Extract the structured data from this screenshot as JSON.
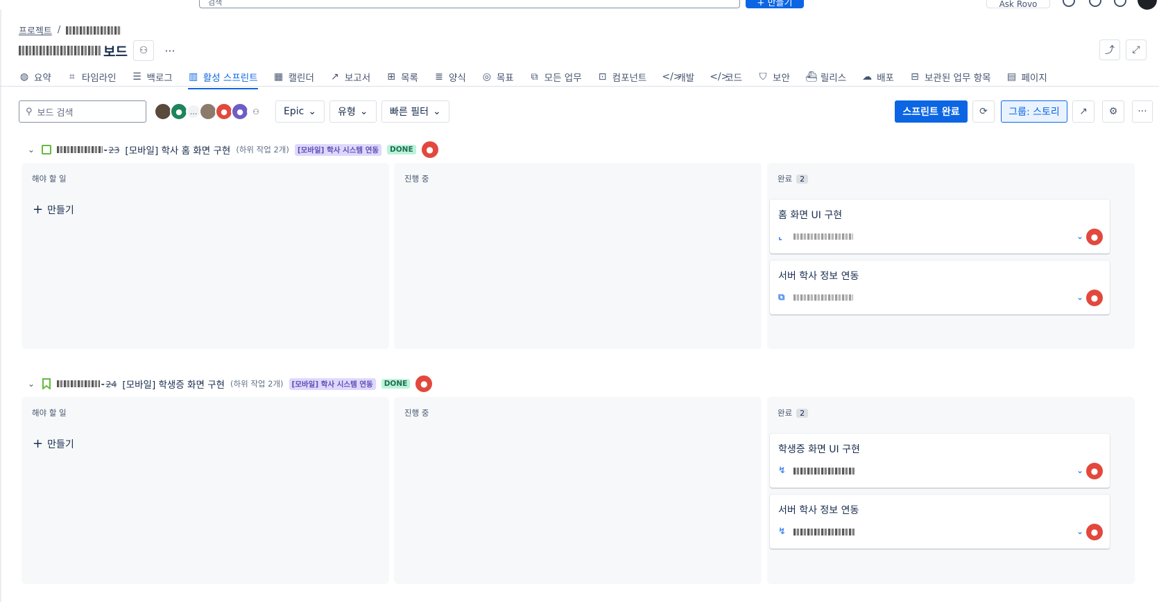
{
  "topbar": {
    "search_placeholder": "검색",
    "create_label": "+ 만들기",
    "rovo_label": "Ask Rovo"
  },
  "breadcrumb": {
    "root": "프로젝트",
    "separator": "/"
  },
  "board": {
    "title_suffix": "보드"
  },
  "tabs": [
    {
      "label": "요약",
      "icon": "globe-icon",
      "glyph": "◍"
    },
    {
      "label": "타임라인",
      "icon": "timeline-icon",
      "glyph": "⌗"
    },
    {
      "label": "백로그",
      "icon": "backlog-icon",
      "glyph": "☰"
    },
    {
      "label": "활성 스프린트",
      "icon": "board-icon",
      "glyph": "▥",
      "active": true
    },
    {
      "label": "캘린더",
      "icon": "calendar-icon",
      "glyph": "▦"
    },
    {
      "label": "보고서",
      "icon": "chart-line-icon",
      "glyph": "↗"
    },
    {
      "label": "목록",
      "icon": "list-icon",
      "glyph": "⊞"
    },
    {
      "label": "양식",
      "icon": "form-icon",
      "glyph": "≣"
    },
    {
      "label": "목표",
      "icon": "goal-icon",
      "glyph": "◎"
    },
    {
      "label": "모든 업무",
      "icon": "all-work-icon",
      "glyph": "⧉"
    },
    {
      "label": "컴포넌트",
      "icon": "component-icon",
      "glyph": "⊡"
    },
    {
      "label": "개발",
      "icon": "code-icon",
      "glyph": "</>"
    },
    {
      "label": "코드",
      "icon": "code-icon",
      "glyph": "</>"
    },
    {
      "label": "보안",
      "icon": "shield-icon",
      "glyph": "⛉"
    },
    {
      "label": "릴리스",
      "icon": "ship-icon",
      "glyph": "⛴"
    },
    {
      "label": "배포",
      "icon": "cloud-upload-icon",
      "glyph": "☁"
    },
    {
      "label": "보관된 업무 항목",
      "icon": "archive-icon",
      "glyph": "⊟"
    },
    {
      "label": "페이지",
      "icon": "page-icon",
      "glyph": "▤"
    }
  ],
  "toolbar": {
    "search_placeholder": "보드 검색",
    "epic_label": "Epic",
    "type_label": "유형",
    "quick_filter_label": "빠른 필터",
    "complete_sprint_label": "스프린트 완료",
    "group_label": "그룹: 스토리",
    "avatar_more": "..."
  },
  "columns": {
    "todo": "해야 할 일",
    "in_progress": "진행 중",
    "done": "완료"
  },
  "create_label": "만들기",
  "swimlanes": [
    {
      "key_suffix": "23",
      "title": "[모바일] 학사 홈 화면 구현",
      "subtasks": "(하위 작업 2개)",
      "epic": "[모바일] 학사 시스템 연동",
      "status": "DONE",
      "done_count": "2",
      "cards": [
        {
          "title": "홈 화면 UI 구현",
          "type_icon": "subtask-icon",
          "glyph": "⌞"
        },
        {
          "title": "서버 학사 정보 연동",
          "type_icon": "subtask-icon",
          "glyph": "⧉"
        }
      ]
    },
    {
      "key_suffix": "24",
      "title": "[모바일] 학생증 화면 구현",
      "subtasks": "(하위 작업 2개)",
      "epic": "[모바일] 학사 시스템 연동",
      "status": "DONE",
      "done_count": "2",
      "cards": [
        {
          "title": "학생증 화면 UI 구현",
          "type_icon": "subtask-icon",
          "glyph": "↯"
        },
        {
          "title": "서버 학사 정보 연동",
          "type_icon": "subtask-icon",
          "glyph": "↯"
        }
      ]
    }
  ],
  "colors": {
    "accent": "#0c66e4",
    "done_bg": "#baf3db",
    "epic_bg": "#dfd8fd",
    "avatar_red": "#e2483d"
  }
}
